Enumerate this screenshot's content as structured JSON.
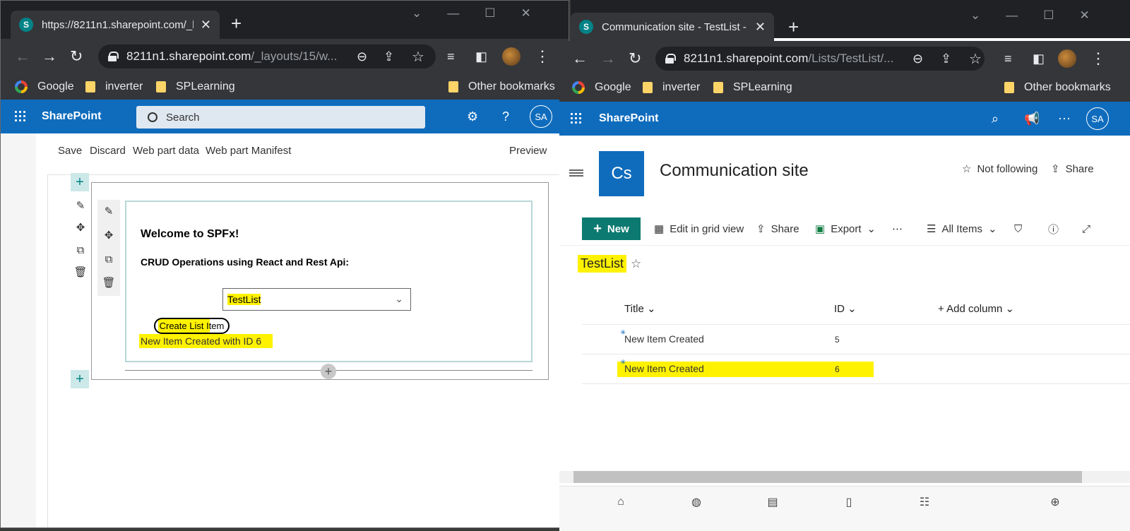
{
  "left_browser": {
    "tab_title": "https://8211n1.sharepoint.com/_l",
    "url_host": "8211n1.sharepoint.com",
    "url_path": "/_layouts/15/w...",
    "bookmarks": [
      "Google",
      "inverter",
      "SPLearning"
    ],
    "other_bookmarks": "Other bookmarks"
  },
  "right_browser": {
    "tab_title": "Communication site - TestList - A",
    "url_host": "8211n1.sharepoint.com",
    "url_path": "/Lists/TestList/...",
    "bookmarks": [
      "Google",
      "inverter",
      "SPLearning"
    ],
    "other_bookmarks": "Other bookmarks"
  },
  "suite": {
    "brand": "SharePoint",
    "search_placeholder": "Search",
    "avatar": "SA"
  },
  "workbench": {
    "toolbar": [
      "Save",
      "Discard",
      "Web part data",
      "Web part Manifest"
    ],
    "preview": "Preview",
    "webpart": {
      "title": "Welcome to SPFx!",
      "subtitle": "CRUD Operations using React and Rest Api:",
      "dropdown_value": "TestList",
      "button_label": "Create List Item",
      "result_message": "New Item Created with ID 6"
    }
  },
  "site": {
    "logo": "Cs",
    "title": "Communication site",
    "follow": "Not following",
    "share": "Share"
  },
  "commands": {
    "new": "New",
    "edit_grid": "Edit in grid view",
    "share": "Share",
    "export": "Export",
    "more": "⋯",
    "view": "All Items"
  },
  "list": {
    "title": "TestList",
    "columns": [
      "Title",
      "ID",
      "Add column"
    ],
    "rows": [
      {
        "title": "New Item Created",
        "id": "5"
      },
      {
        "title": "New Item Created",
        "id": "6"
      }
    ]
  },
  "colors": {
    "suite_blue": "#0f6cbd",
    "new_button": "#0c7a70",
    "highlight": "#fff200",
    "chrome_dark": "#202124"
  }
}
